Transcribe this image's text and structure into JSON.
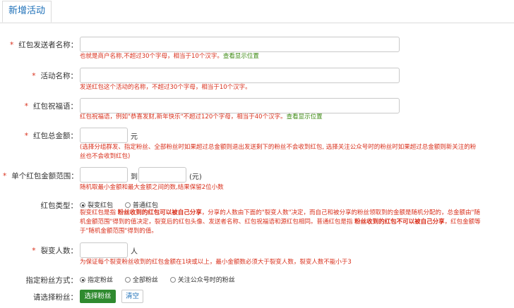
{
  "tab": {
    "label": "新增活动"
  },
  "fields": {
    "sender": {
      "label": "红包发送者名称：",
      "value": "",
      "hint_red": "也就是商户名称,不超过30个字母，相当于10个汉字。",
      "hint_link": "查看显示位置"
    },
    "activity": {
      "label": "活动名称：",
      "value": "",
      "hint_red": "发送红包这个活动的名称，不超过30个字母，相当于10个汉字。"
    },
    "wish": {
      "label": "红包祝福语：",
      "value": "",
      "hint_red": "红包祝福语，例如\"恭喜发财,新年快乐\"不超过120个字母，相当于40个汉字。",
      "hint_link": "查看显示位置"
    },
    "total": {
      "label": "红包总金额：",
      "value": "",
      "unit": "元",
      "hint_line1": "(选择分组群发、指定粉丝、全部粉丝时如果超过总金额则退出发送剩下的粉丝不会收到红包, 选择关注公众号时的粉丝时如果超过总金额则新关注的粉",
      "hint_line2": "丝也不会收到红包)"
    },
    "range": {
      "label": "单个红包金额范围：",
      "min": "",
      "max": "",
      "to": "到",
      "unit": "(元)",
      "hint": "随机取最小金额和最大金额之间的数,结果保留2位小数"
    },
    "type": {
      "label": "红包类型：",
      "options": [
        "裂变红包",
        "普通红包"
      ],
      "selected": "裂变红包",
      "desc1_a": "裂变红包是指 ",
      "desc1_b": "粉丝收到的红包可以被自己分享",
      "desc1_c": "，分享的人数由下面的\"裂变人数\"决定，而自己和被分享的粉丝领取到的金额是随机分配的，总金额由\"随",
      "desc2_a": "机金额范围\"得到的值决定，裂变后的红包头像、发送者名称、红包祝福语和源红包相同。普通红包是指 ",
      "desc2_b": "粉丝收到的红包不可以被自己分享",
      "desc2_c": "，红包金额等",
      "desc3": "于\"随机金额范围\"得到的值。"
    },
    "fission": {
      "label": "裂变人数：",
      "value": "",
      "unit": "人",
      "hint": "为保证每个裂变粉丝收到的红包金额在1块或以上，最小金额数必须大于裂变人数，裂变人数不能小于3"
    },
    "target": {
      "label": "指定粉丝方式：",
      "options": [
        "指定粉丝",
        "全部粉丝",
        "关注公众号时的粉丝"
      ],
      "selected": "指定粉丝"
    },
    "select": {
      "label": "请选择粉丝：",
      "button": "选择粉丝",
      "clear": "清空"
    }
  },
  "required_mark": "*",
  "colors": {
    "accent": "#1c6fb8",
    "error": "#d9301c",
    "link": "#3c8a12",
    "button": "#2f8a2f"
  }
}
